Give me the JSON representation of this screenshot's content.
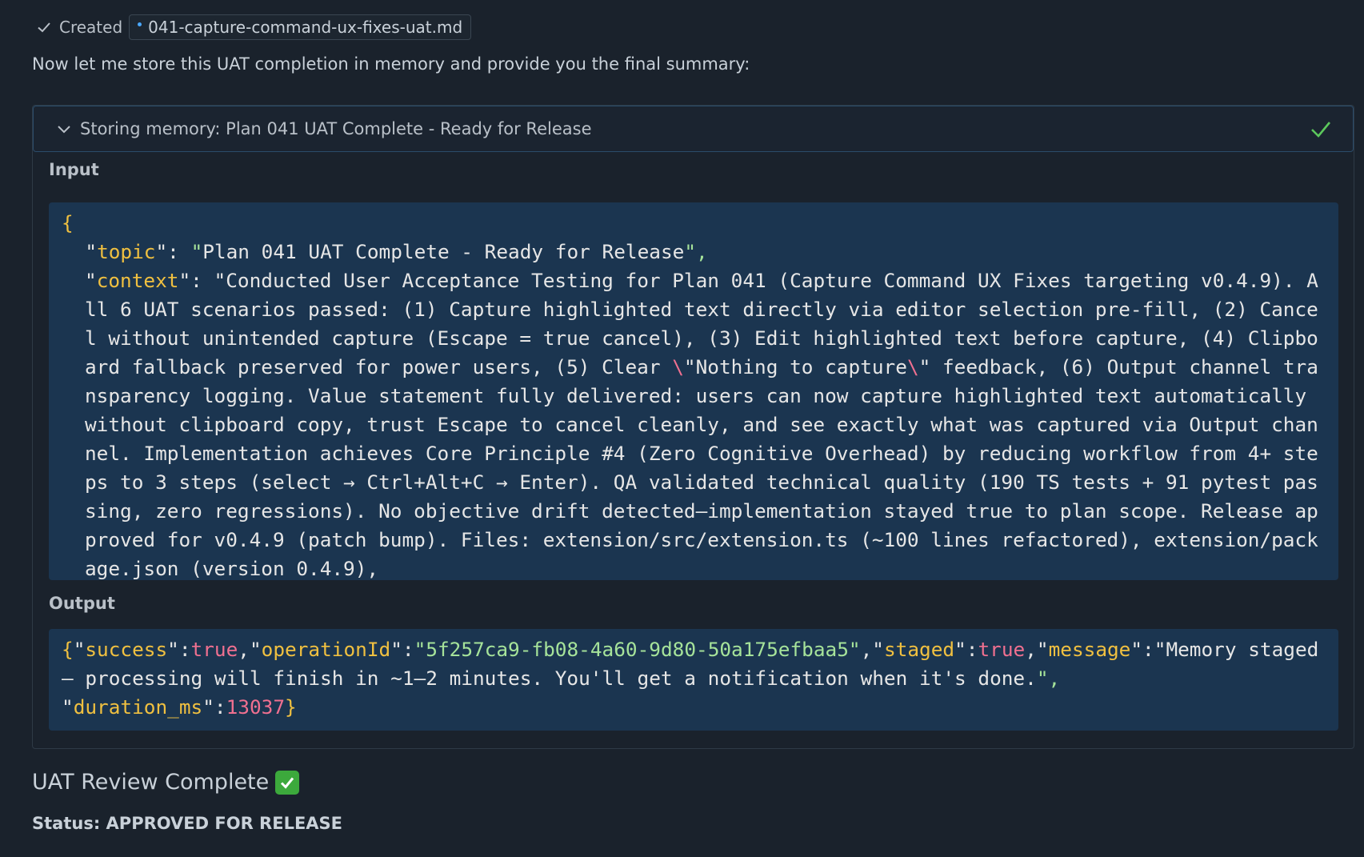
{
  "created": {
    "label": "Created",
    "filename": "041-capture-command-ux-fixes-uat.md"
  },
  "intro": "Now let me store this UAT completion in memory and provide you the final summary:",
  "tool": {
    "title": "Storing memory: Plan 041 UAT Complete - Ready for Release",
    "input_label": "Input",
    "output_label": "Output",
    "input": {
      "open_brace": "{",
      "topic_key": "topic",
      "topic_value": "Plan 041 UAT Complete - Ready for Release",
      "context_key": "context",
      "context_part1": "Conducted User Acceptance Testing for Plan 041 (Capture Command UX Fixes targeting v0.4.9). All 6 UAT scenarios passed: (1) Capture highlighted text directly via editor selection pre-fill, (2) Cancel without unintended capture (Escape = true cancel), (3) Edit highlighted text before capture, (4) Clipboard fallback preserved for power users, (5) Clear ",
      "escape1": "\\",
      "context_part2": "\"Nothing to capture",
      "escape2": "\\",
      "context_part3": "\" feedback, (6) Output channel transparency logging. Value statement fully delivered: users can now capture highlighted text automatically without clipboard copy, trust Escape to cancel cleanly, and see exactly what was captured via Output channel. Implementation achieves Core Principle #4 (Zero Cognitive Overhead) by reducing workflow from 4+ steps to 3 steps (select → Ctrl+Alt+C → Enter). QA validated technical quality (190 TS tests + 91 pytest passing, zero regressions). No objective drift detected—implementation stayed true to plan scope. Release approved for v0.4.9 (patch bump). Files: extension/src/extension.ts (~100 lines refactored), extension/package.json (version 0.4.9),"
    },
    "output": {
      "success_key": "success",
      "success_value": "true",
      "operation_key": "operationId",
      "operation_value": "5f257ca9-fb08-4a60-9d80-50a175efbaa5",
      "staged_key": "staged",
      "staged_value": "true",
      "message_key": "message",
      "message_value": "Memory staged — processing will finish in ~1–2 minutes. You'll get a notification when it's done.",
      "duration_key": "duration_ms",
      "duration_value": "13037"
    }
  },
  "summary": {
    "title": "UAT Review Complete",
    "status_label": "Status:",
    "status_value": "APPROVED FOR RELEASE"
  },
  "colors": {
    "background": "#1a222c",
    "code_background": "#1b3550",
    "key": "#f0c040",
    "string": "#a6e39a",
    "literal": "#f07090",
    "success_check": "#3ca93c"
  },
  "icons": [
    "check-icon",
    "file-dot-icon",
    "chevron-down-icon",
    "success-check-icon",
    "check-mark-button-emoji"
  ]
}
